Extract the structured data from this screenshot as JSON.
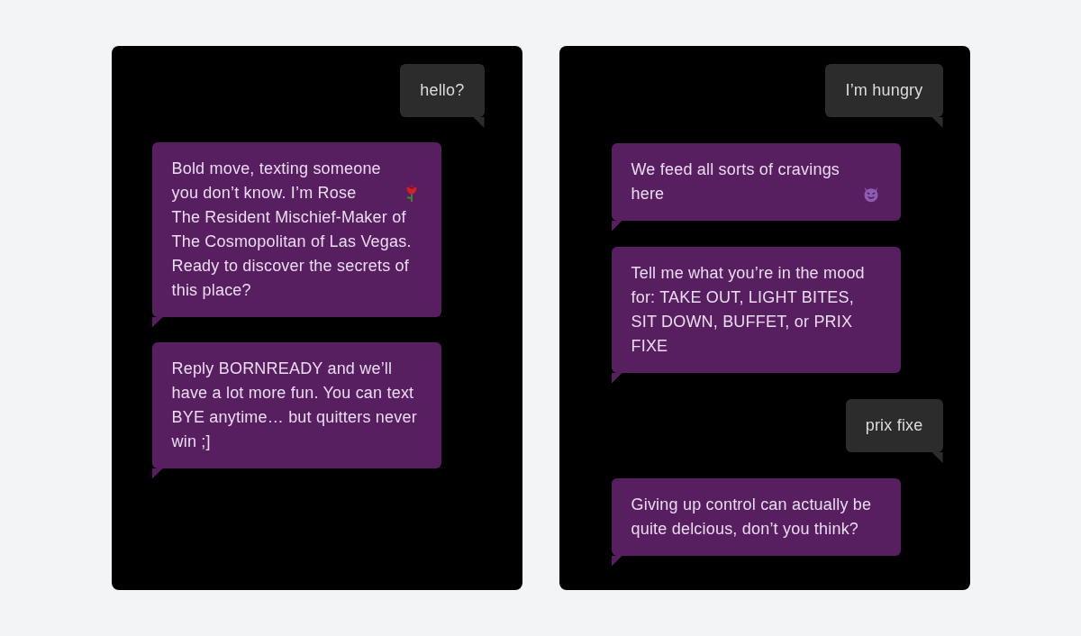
{
  "conversations": [
    {
      "messages": [
        {
          "kind": "outgoing",
          "parts": [
            {
              "kind": "text",
              "text": "hello?"
            }
          ]
        },
        {
          "kind": "incoming",
          "parts": [
            {
              "kind": "text",
              "text": "Bold move, texting someone you don’t know. I’m Rose"
            },
            {
              "kind": "rose"
            },
            {
              "kind": "text",
              "text": "The Resident Mischief-Maker of The Cosmopolitan of Las Vegas. Ready to discover the secrets of this place?"
            }
          ]
        },
        {
          "kind": "incoming",
          "parts": [
            {
              "kind": "text",
              "text": "Reply BORNREADY and we’ll have a lot more fun. You can text BYE anytime… but quitters never win ;]"
            }
          ]
        }
      ]
    },
    {
      "messages": [
        {
          "kind": "outgoing",
          "parts": [
            {
              "kind": "text",
              "text": "I’m hungry"
            }
          ]
        },
        {
          "kind": "incoming",
          "parts": [
            {
              "kind": "text",
              "text": "We feed all sorts of cravings here"
            },
            {
              "kind": "devil"
            }
          ]
        },
        {
          "kind": "incoming",
          "parts": [
            {
              "kind": "text",
              "text": "Tell me what you’re in the mood for: TAKE OUT, LIGHT BITES, SIT DOWN, BUFFET, or PRIX FIXE"
            }
          ]
        },
        {
          "kind": "outgoing",
          "parts": [
            {
              "kind": "text",
              "text": "prix fixe"
            }
          ]
        },
        {
          "kind": "incoming",
          "parts": [
            {
              "kind": "text",
              "text": "Giving up control can actually be quite delcious, don’t you think?"
            }
          ]
        }
      ]
    }
  ]
}
